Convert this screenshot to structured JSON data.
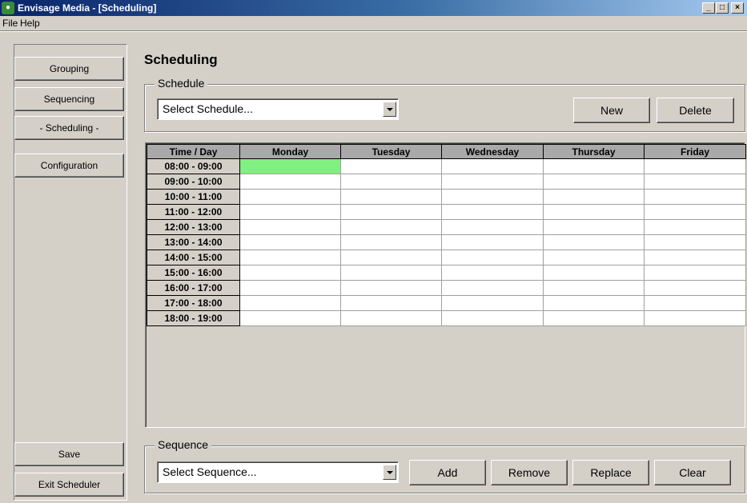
{
  "window": {
    "title": "Envisage Media - [Scheduling]",
    "icon": "envisage-app-icon"
  },
  "menu": [
    "File",
    "Help"
  ],
  "sidebar": {
    "nav": [
      {
        "label": "Grouping"
      },
      {
        "label": "Sequencing"
      },
      {
        "label": "- Scheduling -"
      },
      {
        "label": "Configuration"
      }
    ],
    "save_label": "Save",
    "exit_label": "Exit Scheduler"
  },
  "main": {
    "title": "Scheduling",
    "schedule_group": {
      "label": "Schedule",
      "select_value": "Select Schedule...",
      "new_label": "New",
      "delete_label": "Delete"
    },
    "grid": {
      "headers": [
        "Time / Day",
        "Monday",
        "Tuesday",
        "Wednesday",
        "Thursday",
        "Friday"
      ],
      "time_slots": [
        "08:00 - 09:00",
        "09:00 - 10:00",
        "10:00 - 11:00",
        "11:00 - 12:00",
        "12:00 - 13:00",
        "13:00 - 14:00",
        "14:00 - 15:00",
        "15:00 - 16:00",
        "16:00 - 17:00",
        "17:00 - 18:00",
        "18:00 - 19:00"
      ],
      "selected_cell": {
        "slot": "08:00 - 09:00",
        "day": "Monday"
      },
      "selected_color": "#80f080"
    },
    "sequence_group": {
      "label": "Sequence",
      "select_value": "Select Sequence...",
      "add_label": "Add",
      "remove_label": "Remove",
      "replace_label": "Replace",
      "clear_label": "Clear"
    }
  }
}
